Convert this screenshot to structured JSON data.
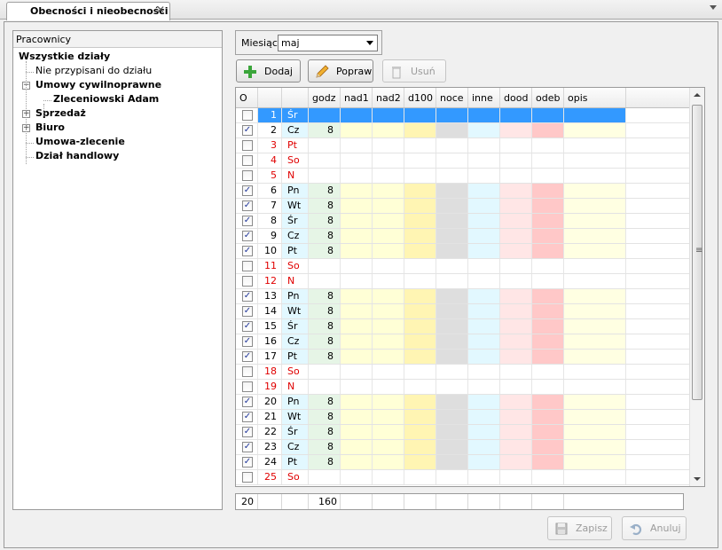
{
  "tab": {
    "title": "Obecności i nieobecności",
    "close": "✕"
  },
  "left_panel": {
    "header": "Pracownicy",
    "tree": [
      {
        "label": "Wszystkie działy",
        "bold": true,
        "level": 0
      },
      {
        "label": "Nie przypisani do działu",
        "bold": false,
        "level": 1
      },
      {
        "label": "Umowy cywilnoprawne",
        "bold": true,
        "level": 1,
        "expanded": true
      },
      {
        "label": "Zleceniowski Adam",
        "bold": true,
        "level": 2,
        "selected": true
      },
      {
        "label": "Sprzedaż",
        "bold": true,
        "level": 1,
        "collapsed": true
      },
      {
        "label": "Biuro",
        "bold": true,
        "level": 1,
        "collapsed": true
      },
      {
        "label": "Umowa-zlecenie",
        "bold": true,
        "level": 1
      },
      {
        "label": "Dział handlowy",
        "bold": true,
        "level": 1
      }
    ]
  },
  "month": {
    "label": "Miesiąc",
    "value": "maj"
  },
  "toolbar": {
    "add_label": "Dodaj",
    "edit_label": "Popraw",
    "delete_label": "Usuń"
  },
  "grid": {
    "columns": [
      "O",
      "",
      "",
      "godz",
      "nad1",
      "nad2",
      "d100",
      "noce",
      "inne",
      "dood",
      "odeb",
      "opis"
    ],
    "rows": [
      {
        "checked": false,
        "day": "1",
        "wd": "Śr",
        "hours": "",
        "selected": true
      },
      {
        "checked": true,
        "day": "2",
        "wd": "Cz",
        "hours": "8"
      },
      {
        "checked": false,
        "day": "3",
        "wd": "Pt",
        "hours": "",
        "red": true
      },
      {
        "checked": false,
        "day": "4",
        "wd": "So",
        "hours": "",
        "red": true
      },
      {
        "checked": false,
        "day": "5",
        "wd": "N",
        "hours": "",
        "red": true
      },
      {
        "checked": true,
        "day": "6",
        "wd": "Pn",
        "hours": "8"
      },
      {
        "checked": true,
        "day": "7",
        "wd": "Wt",
        "hours": "8"
      },
      {
        "checked": true,
        "day": "8",
        "wd": "Śr",
        "hours": "8"
      },
      {
        "checked": true,
        "day": "9",
        "wd": "Cz",
        "hours": "8"
      },
      {
        "checked": true,
        "day": "10",
        "wd": "Pt",
        "hours": "8"
      },
      {
        "checked": false,
        "day": "11",
        "wd": "So",
        "hours": "",
        "red": true
      },
      {
        "checked": false,
        "day": "12",
        "wd": "N",
        "hours": "",
        "red": true
      },
      {
        "checked": true,
        "day": "13",
        "wd": "Pn",
        "hours": "8"
      },
      {
        "checked": true,
        "day": "14",
        "wd": "Wt",
        "hours": "8"
      },
      {
        "checked": true,
        "day": "15",
        "wd": "Śr",
        "hours": "8"
      },
      {
        "checked": true,
        "day": "16",
        "wd": "Cz",
        "hours": "8"
      },
      {
        "checked": true,
        "day": "17",
        "wd": "Pt",
        "hours": "8"
      },
      {
        "checked": false,
        "day": "18",
        "wd": "So",
        "hours": "",
        "red": true
      },
      {
        "checked": false,
        "day": "19",
        "wd": "N",
        "hours": "",
        "red": true
      },
      {
        "checked": true,
        "day": "20",
        "wd": "Pn",
        "hours": "8"
      },
      {
        "checked": true,
        "day": "21",
        "wd": "Wt",
        "hours": "8"
      },
      {
        "checked": true,
        "day": "22",
        "wd": "Śr",
        "hours": "8"
      },
      {
        "checked": true,
        "day": "23",
        "wd": "Cz",
        "hours": "8"
      },
      {
        "checked": true,
        "day": "24",
        "wd": "Pt",
        "hours": "8"
      },
      {
        "checked": false,
        "day": "25",
        "wd": "So",
        "hours": "",
        "red": true
      }
    ],
    "totals": {
      "count": "20",
      "hours": "160"
    }
  },
  "footer": {
    "save_label": "Zapisz",
    "cancel_label": "Anuluj"
  },
  "colors": {
    "selection": "#3399ff",
    "weekend_text": "#e00000",
    "godz": "#e6f5e6",
    "nad": "#ffffd6",
    "d100": "#fff5b3",
    "noce": "#dedede",
    "inne": "#e2f8ff",
    "dood": "#ffe6e6",
    "odeb": "#ffc8c8",
    "opis": "#ffffe2"
  },
  "icons": {
    "add": "plus-icon",
    "edit": "pencil-icon",
    "delete": "trash-icon",
    "save": "floppy-icon",
    "cancel": "undo-icon"
  }
}
